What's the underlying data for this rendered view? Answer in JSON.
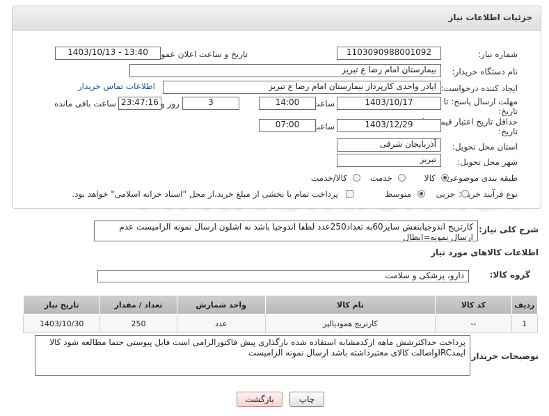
{
  "page": {
    "title": "جزئیات اطلاعات نیاز"
  },
  "fields": {
    "need_number_label": "شماره نیاز:",
    "need_number": "1103090988001092",
    "announce_label": "تاریخ و ساعت اعلان عمومی:",
    "announce_value": "1403/10/13 - 13:40",
    "buyer_org_label": "نام دستگاه خریدار:",
    "buyer_org": "بیمارستان امام رضا  ع  تبریز",
    "creator_label": "ایجاد کننده درخواست:",
    "creator": "ایادر واحدی کارپرداز بیمارستان امام رضا  ع  تبریز",
    "contact_link": "اطلاعات تماس خریدار",
    "reply_deadline_label_1": "مهلت ارسال پاسخ: تا",
    "reply_deadline_label_2": "تاریخ:",
    "reply_date": "1403/10/17",
    "time_label": "ساعت",
    "reply_time": "14:00",
    "days_value": "3",
    "days_label": "روز و",
    "remaining_time": "23:47:16",
    "remaining_label": "ساعت باقی مانده",
    "price_validity_label_1": "حداقل تاریخ اعتبار قیمت: تا",
    "price_validity_label_2": "تاریخ:",
    "price_date": "1403/12/29",
    "price_time_label": "ساعت",
    "price_time": "07:00",
    "province_label": "استان محل تحویل:",
    "province": "آذربایجان شرقی",
    "city_label": "شهر محل تحویل:",
    "city": "تبریز",
    "category_label": "طبقه بندی موضوعی:",
    "category_options": [
      "کالا",
      "خدمت",
      "کالا/خدمت"
    ],
    "process_label": "نوع فرآیند خرید :",
    "process_options": [
      "جزیی",
      "متوسط"
    ],
    "payment_note": "پرداخت تمام یا بخشی از مبلغ خرید،از محل \"اسناد خزانه اسلامی\" خواهد بود."
  },
  "description": {
    "label": "شرح کلی نیاز:",
    "text": "کارتریج اندوجیابنفش سایز60به تعداد250عدد لطفا اندوجیا باشد نه اشلون ارسال نمونه الزامیست عدم ارسال نمونه=ابطال"
  },
  "goods_info": {
    "title": "اطلاعات کالاهای مورد نیاز",
    "group_label": "گروه کالا:",
    "group_value": "دارو، پزشکی و سلامت",
    "columns": [
      "ردیف",
      "کد کالا",
      "نام کالا",
      "واحد شمارش",
      "تعداد / مقدار",
      "تاریخ نیاز"
    ],
    "rows": [
      {
        "row": "1",
        "code": "--",
        "name": "کارتریج همودیالیز",
        "unit": "عدد",
        "qty": "250",
        "date": "1403/10/30"
      }
    ]
  },
  "buyer_notes": {
    "label": "توضیحات خریدار:",
    "text": "پرداخت حداکثرشش ماهه ازکدمشابه استفاده شده بارگذاری پیش فاکتورالزامی است فایل پیوستی حتما مطالعه شود کالا ایمدIRCواصالت کالای معتبرداشته باشد ارسال نمونه الزامیست"
  },
  "buttons": {
    "print": "چاپ",
    "back": "بازگشت"
  },
  "watermark": "AriaTender.neT"
}
